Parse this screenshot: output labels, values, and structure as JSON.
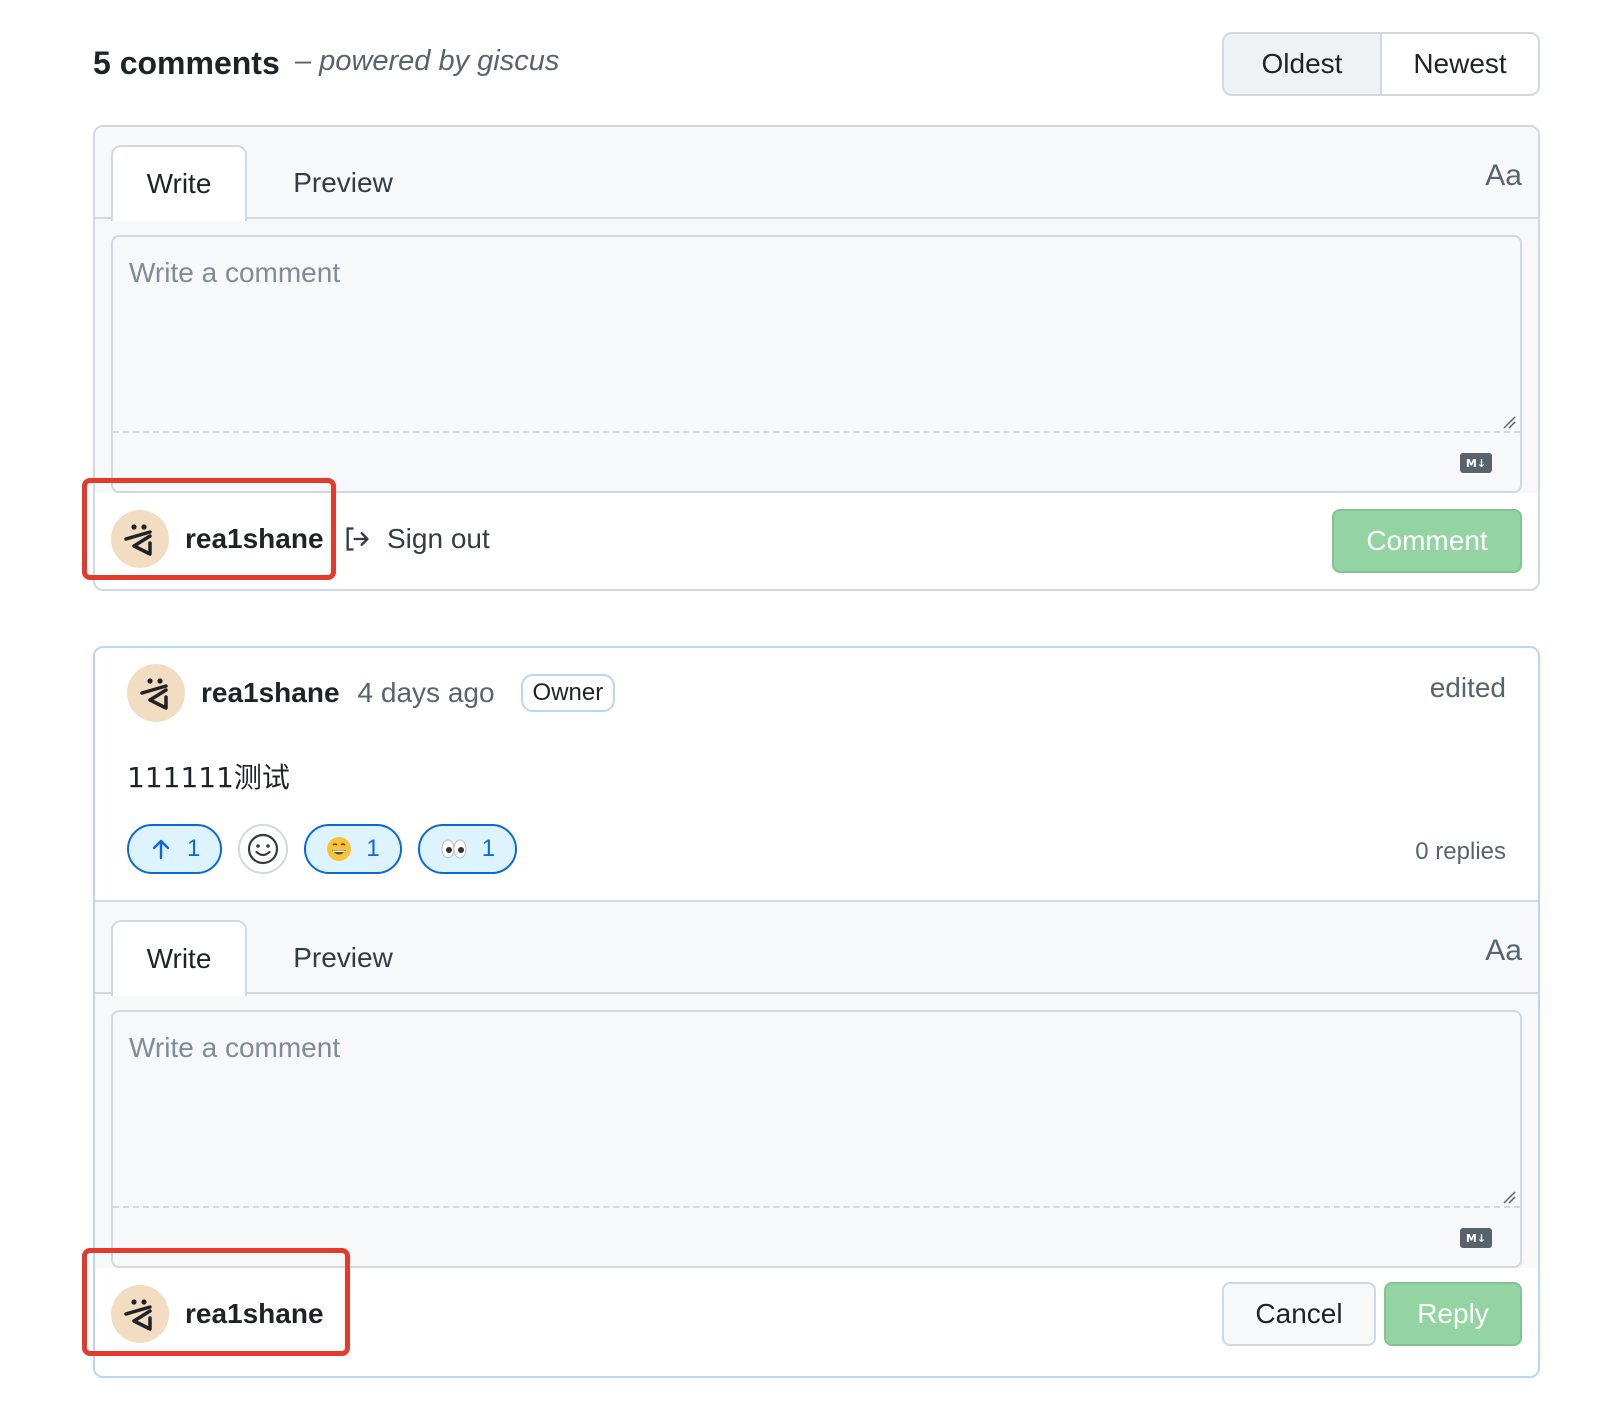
{
  "header": {
    "count": "5 comments",
    "powered_by": "– powered by giscus",
    "sort": {
      "oldest": "Oldest",
      "newest": "Newest",
      "active": "Oldest"
    }
  },
  "main_editor": {
    "tab_write": "Write",
    "tab_preview": "Preview",
    "font_toggle": "Aa",
    "placeholder": "Write a comment",
    "markdown_badge": "M↓",
    "username": "rea1shane",
    "sign_out": "Sign out",
    "submit": "Comment"
  },
  "comment": {
    "author": "rea1shane",
    "time": "4 days ago",
    "badge": "Owner",
    "edited": "edited",
    "body": "111111测试",
    "reactions": [
      {
        "icon": "arrow-up-icon",
        "count": "1"
      },
      {
        "icon": "smile-emoji",
        "count": "1"
      },
      {
        "icon": "eyes-emoji",
        "count": "1"
      }
    ],
    "replies": "0 replies"
  },
  "reply_editor": {
    "tab_write": "Write",
    "tab_preview": "Preview",
    "font_toggle": "Aa",
    "placeholder": "Write a comment",
    "markdown_badge": "M↓",
    "username": "rea1shane",
    "cancel": "Cancel",
    "submit": "Reply"
  },
  "colors": {
    "accent_blue": "#0969da",
    "highlight_red": "#e53a2b",
    "disabled_green": "#94d3a2"
  }
}
